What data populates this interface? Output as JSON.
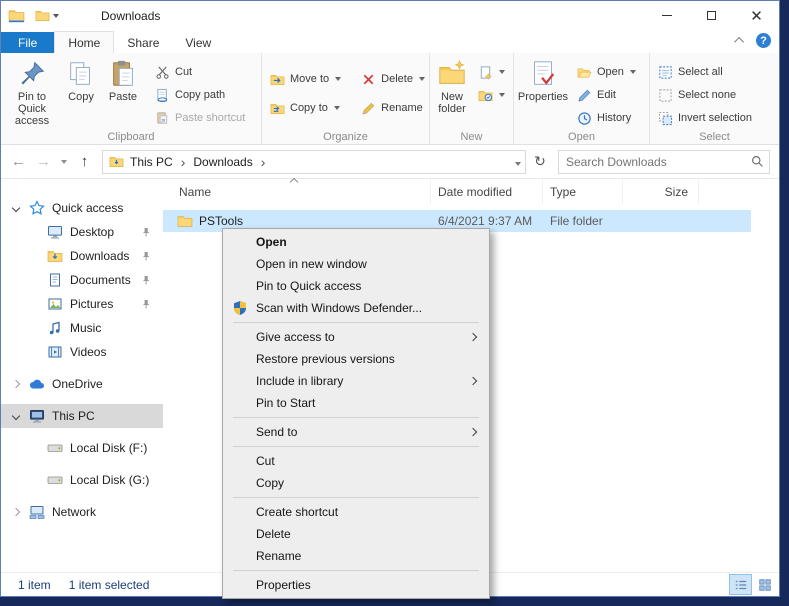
{
  "window": {
    "title": "Downloads"
  },
  "ribbon": {
    "tabs": [
      "File",
      "Home",
      "Share",
      "View"
    ],
    "active_tab": "Home",
    "clipboard": {
      "label": "Clipboard",
      "pin_to_quick_access": "Pin to Quick access",
      "copy": "Copy",
      "paste": "Paste",
      "cut": "Cut",
      "copy_path": "Copy path",
      "paste_shortcut": "Paste shortcut"
    },
    "organize": {
      "label": "Organize",
      "move_to": "Move to",
      "copy_to": "Copy to",
      "delete": "Delete",
      "rename": "Rename"
    },
    "new": {
      "label": "New",
      "new_folder": "New folder"
    },
    "open": {
      "label": "Open",
      "properties": "Properties",
      "open": "Open",
      "edit": "Edit",
      "history": "History"
    },
    "select": {
      "label": "Select",
      "select_all": "Select all",
      "select_none": "Select none",
      "invert_selection": "Invert selection"
    }
  },
  "address_bar": {
    "path": [
      "This PC",
      "Downloads"
    ],
    "search_placeholder": "Search Downloads"
  },
  "sidebar": {
    "items": [
      {
        "label": "Quick access"
      },
      {
        "label": "Desktop",
        "pinned": true
      },
      {
        "label": "Downloads",
        "pinned": true
      },
      {
        "label": "Documents",
        "pinned": true
      },
      {
        "label": "Pictures",
        "pinned": true
      },
      {
        "label": "Music"
      },
      {
        "label": "Videos"
      },
      {
        "label": "OneDrive"
      },
      {
        "label": "This PC",
        "selected": true
      },
      {
        "label": "Local Disk (F:)"
      },
      {
        "label": "Local Disk (G:)"
      },
      {
        "label": "Network"
      }
    ]
  },
  "file_list": {
    "columns": {
      "name": "Name",
      "date_modified": "Date modified",
      "type": "Type",
      "size": "Size"
    },
    "rows": [
      {
        "name": "PSTools",
        "date_modified": "6/4/2021 9:37 AM",
        "type": "File folder",
        "size": "",
        "selected": true
      }
    ]
  },
  "context_menu": {
    "items": [
      {
        "label": "Open",
        "bold": true
      },
      {
        "label": "Open in new window"
      },
      {
        "label": "Pin to Quick access"
      },
      {
        "label": "Scan with Windows Defender...",
        "icon": "defender"
      },
      {
        "label": "Give access to",
        "submenu": true
      },
      {
        "label": "Restore previous versions"
      },
      {
        "label": "Include in library",
        "submenu": true
      },
      {
        "label": "Pin to Start"
      },
      {
        "label": "Send to",
        "submenu": true
      },
      {
        "label": "Cut"
      },
      {
        "label": "Copy"
      },
      {
        "label": "Create shortcut"
      },
      {
        "label": "Delete"
      },
      {
        "label": "Rename"
      },
      {
        "label": "Properties"
      }
    ]
  },
  "status_bar": {
    "items_count": "1 item",
    "selected_count": "1 item selected"
  },
  "colors": {
    "file_tab_blue": "#1979ca",
    "selection_fill": "#cce8ff",
    "sidebar_selected": "#d9d9d9",
    "context_menu_bg": "#eeeeee",
    "desktop_background": "#16295a"
  }
}
